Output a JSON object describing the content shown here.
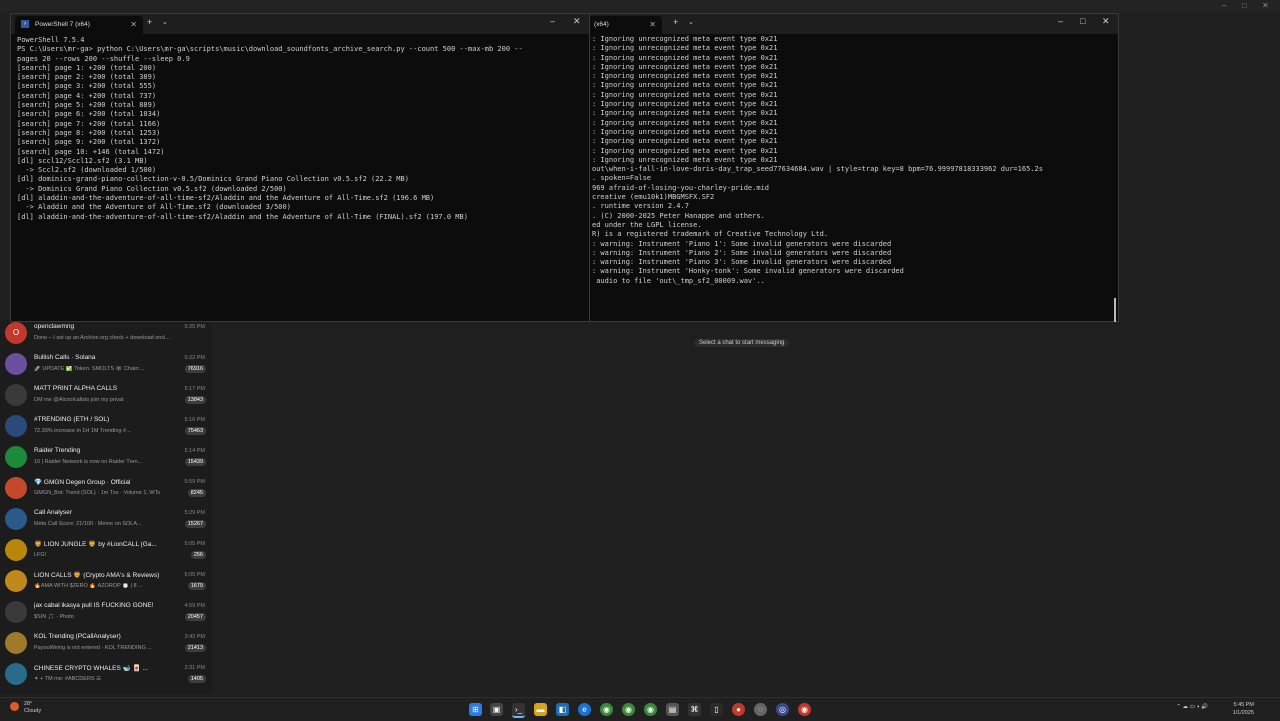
{
  "left_terminal": {
    "tab_title": "PowerShell 7 (x64)",
    "lines": [
      "PowerShell 7.5.4",
      "PS C:\\Users\\mr-ga> python C:\\Users\\mr-ga\\scripts\\music\\download_soundfonts_archive_search.py --count 500 --max-mb 200 --",
      "pages 20 --rows 200 --shuffle --sleep 0.9",
      "[search] page 1: +200 (total 200)",
      "[search] page 2: +200 (total 389)",
      "[search] page 3: +200 (total 555)",
      "[search] page 4: +200 (total 737)",
      "[search] page 5: +200 (total 889)",
      "[search] page 6: +200 (total 1034)",
      "[search] page 7: +200 (total 1166)",
      "[search] page 8: +200 (total 1253)",
      "[search] page 9: +200 (total 1372)",
      "[search] page 10: +146 (total 1472)",
      "[dl] sccl12/Sccl12.sf2 (3.1 MB)",
      "  -> Sccl2.sf2 (downloaded 1/500)",
      "[dl] dominics-grand-piano-collection-v-0.5/Dominics Grand Piano Collection v0.5.sf2 (22.2 MB)",
      "  -> Dominics Grand Piano Collection v0.5.sf2 (downloaded 2/500)",
      "[dl] aladdin-and-the-adventure-of-all-time-sf2/Aladdin and the Adventure of All-Time.sf2 (196.6 MB)",
      "  -> Aladdin and the Adventure of All-Time.sf2 (downloaded 3/500)",
      "[dl] aladdin-and-the-adventure-of-all-time-sf2/Aladdin and the Adventure of All-Time (FINAL).sf2 (197.0 MB)"
    ]
  },
  "right_terminal": {
    "tab_title": "(x64)",
    "lines": [
      ": Ignoring unrecognized meta event type 0x21",
      ": Ignoring unrecognized meta event type 0x21",
      ": Ignoring unrecognized meta event type 0x21",
      ": Ignoring unrecognized meta event type 0x21",
      ": Ignoring unrecognized meta event type 0x21",
      ": Ignoring unrecognized meta event type 0x21",
      ": Ignoring unrecognized meta event type 0x21",
      ": Ignoring unrecognized meta event type 0x21",
      ": Ignoring unrecognized meta event type 0x21",
      ": Ignoring unrecognized meta event type 0x21",
      ": Ignoring unrecognized meta event type 0x21",
      ": Ignoring unrecognized meta event type 0x21",
      ": Ignoring unrecognized meta event type 0x21",
      ": Ignoring unrecognized meta event type 0x21",
      "out\\when-i-fall-in-love-doris-day_trap_seed77634684.wav | style=trap key=8 bpm=76.99997818333962 dur=165.2s",
      "",
      ". spoken=False",
      "969 afraid-of-losing-you-charley-pride.mid",
      "creative (emu10k1)MBGMSFX.SF2",
      ". runtime version 2.4.7",
      ". (C) 2000-2025 Peter Hanappe and others.",
      "ed under the LGPL license.",
      "R) is a registered trademark of Creative Technology Ltd.",
      "",
      ": warning: Instrument 'Piano 1': Some invalid generators were discarded",
      ": warning: Instrument 'Piano 2': Some invalid generators were discarded",
      ": warning: Instrument 'Piano 3': Some invalid generators were discarded",
      ": warning: Instrument 'Honky-tonk': Some invalid generators were discarded",
      " audio to file 'out\\_tmp_sf2_00009.wav'.."
    ]
  },
  "chats": [
    {
      "name": "openclawmng",
      "time": "5:25 PM",
      "preview": "Done – I set up an Archive.org check + download oncl...",
      "badge": "",
      "color": "#c0392b",
      "avatar_text": "O"
    },
    {
      "name": "Bullish Calls · Solana",
      "time": "5:22 PM",
      "preview": "🚀 UPDATE ✅ Token: SMOLTS 🕸 Chain:...",
      "badge": "76916",
      "color": "#6b4fa0",
      "avatar_text": ""
    },
    {
      "name": "MATT PRINT ALPHA CALLS",
      "time": "5:17 PM",
      "preview": "DM me @Alcoolcallsto join my privat",
      "badge": "13843",
      "color": "#3a3a3a",
      "avatar_text": ""
    },
    {
      "name": "#TRENDING (ETH / SOL)",
      "time": "5:16 PM",
      "preview": "72.39% increase in 1H 1M Trending #...",
      "badge": "75463",
      "color": "#2a4a7a",
      "avatar_text": ""
    },
    {
      "name": "Raider Trending",
      "time": "5:14 PM",
      "preview": "10 | Raider Network is now on Raider Tren...",
      "badge": "15439",
      "color": "#1c8a3a",
      "avatar_text": ""
    },
    {
      "name": "💎 GMGN Degen Group · Official",
      "time": "5:59 PM",
      "preview": "GMGN_Bot: Trend (SOL) · 1m Txs · Volume 1, WTs",
      "badge": "8245",
      "color": "#c24a2a",
      "avatar_text": ""
    },
    {
      "name": "Call Analyser",
      "time": "5:29 PM",
      "preview": "Meta Call Score: 21/100 · Meme on SOLA...",
      "badge": "15267",
      "color": "#2a5a8a",
      "avatar_text": ""
    },
    {
      "name": "🦁 LION JUNGLE 🦁 by #LionCALL (Ga...",
      "time": "5:05 PM",
      "preview": "LFG!",
      "badge": "256",
      "color": "#b8860b",
      "avatar_text": ""
    },
    {
      "name": "LION CALLS 🦁 (Crypto AMA's & Reviews)",
      "time": "5:05 PM",
      "preview": "🔥AMA WITH $ZERO 🔥 AZOROP ⏰ | 8 ...",
      "badge": "1679",
      "color": "#c08a1a",
      "avatar_text": ""
    },
    {
      "name": "jax cabal ikasya pull IS FUCKING GONE!",
      "time": "4:59 PM",
      "preview": "$SIN 🎵 · Photo",
      "badge": "20457",
      "color": "#3a3a3a",
      "avatar_text": ""
    },
    {
      "name": "KOL Trending (PCallAnalyser)",
      "time": "3:43 PM",
      "preview": "PayouWeing is not entered · KOL TRENDING ...",
      "badge": "21413",
      "color": "#a07a2a",
      "avatar_text": ""
    },
    {
      "name": "CHINESE CRYPTO WHALES 🐋 🀄 ...",
      "time": "2:31 PM",
      "preview": "✦ + TM me: #ABCDERS ☰",
      "badge": "1405",
      "color": "#2a6a8a",
      "avatar_text": ""
    }
  ],
  "select_chat_hint": "Select a chat to start messaging",
  "taskbar": {
    "weather_temp": "28°",
    "weather_text": "Cloudy",
    "clock_time": "5:45 PM",
    "clock_date": "1/1/2025"
  }
}
